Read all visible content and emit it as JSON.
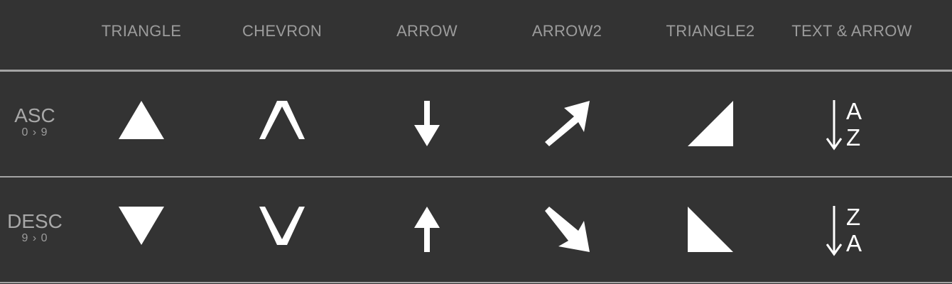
{
  "columns": [
    {
      "label": "TRIANGLE"
    },
    {
      "label": "CHEVRON"
    },
    {
      "label": "ARROW"
    },
    {
      "label": "ARROW2"
    },
    {
      "label": "TRIANGLE2"
    },
    {
      "label": "TEXT & ARROW"
    }
  ],
  "rows": {
    "asc": {
      "label": "ASC",
      "sub": "0 › 9",
      "letters": [
        "A",
        "Z"
      ]
    },
    "desc": {
      "label": "DESC",
      "sub": "9 › 0",
      "letters": [
        "Z",
        "A"
      ]
    }
  },
  "colors": {
    "background": "#333333",
    "icon": "#ffffff",
    "header_text": "#9c9c9c",
    "rule": "#a4a4a4"
  },
  "icons": {
    "asc": [
      "triangle-up-icon",
      "chevron-up-icon",
      "arrow-down-icon",
      "arrow-up-right-icon",
      "triangle2-up-icon",
      "text-arrow-down-icon"
    ],
    "desc": [
      "triangle-down-icon",
      "chevron-down-icon",
      "arrow-up-icon",
      "arrow-down-right-icon",
      "triangle2-down-icon",
      "text-arrow-down-icon"
    ]
  }
}
